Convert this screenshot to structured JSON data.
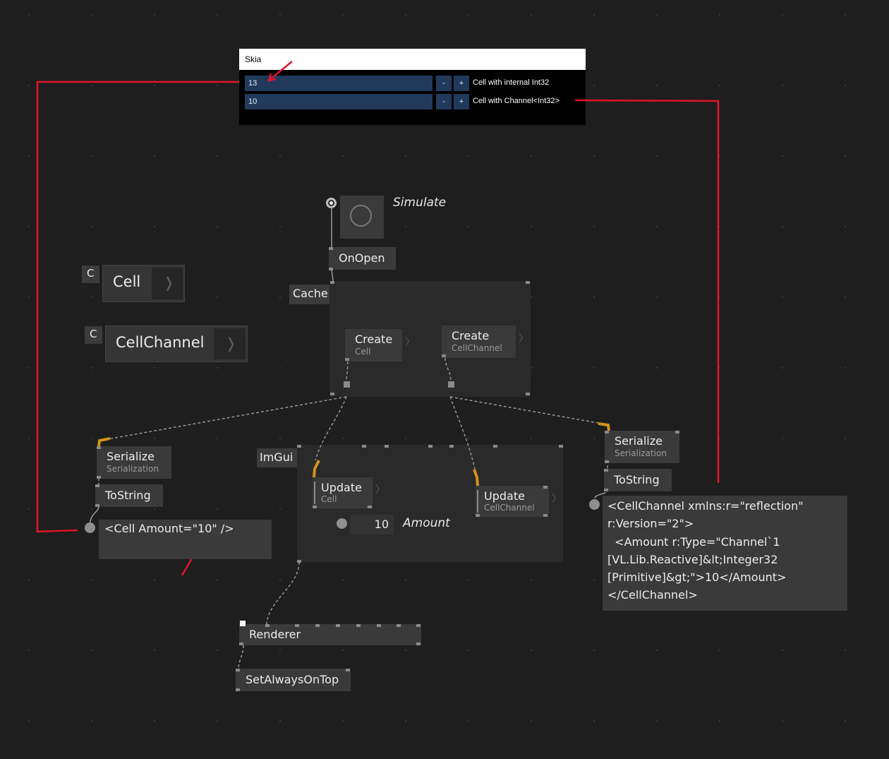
{
  "skia_window": {
    "title": "Skia",
    "rows": [
      {
        "value": "13",
        "minus": "-",
        "plus": "+",
        "label": "Cell with internal Int32"
      },
      {
        "value": "10",
        "minus": "-",
        "plus": "+",
        "label": "Cell with Channel<Int32>"
      }
    ]
  },
  "patch": {
    "simulate_label": "Simulate",
    "on_open": "OnOpen",
    "cache_label": "Cache",
    "class_cell": {
      "badge": "C",
      "name": "Cell",
      "chevron": "❭"
    },
    "class_cellchannel": {
      "badge": "C",
      "name": "CellChannel",
      "chevron": "❭"
    },
    "create_cell": {
      "title": "Create",
      "subtitle": "Cell",
      "chevron": "〉"
    },
    "create_cellchannel": {
      "title": "Create",
      "subtitle": "CellChannel",
      "chevron": "〉"
    },
    "imgui_label": "ImGui",
    "update_cell": {
      "title": "Update",
      "subtitle": "Cell",
      "chevron": "〉"
    },
    "update_cellchannel": {
      "title": "Update",
      "subtitle": "CellChannel",
      "chevron": "〉"
    },
    "amount_value": "10",
    "amount_label": "Amount",
    "serialize_left": {
      "title": "Serialize",
      "subtitle": "Serialization"
    },
    "serialize_right": {
      "title": "Serialize",
      "subtitle": "Serialization"
    },
    "tostring_left": "ToString",
    "tostring_right": "ToString",
    "output_left": "<Cell Amount=\"10\" />",
    "output_right_lines": [
      "<CellChannel xmlns:r=\"reflection\"",
      "r:Version=\"2\">",
      "  <Amount r:Type=\"Channel`1",
      "[VL.Lib.Reactive]&lt;Integer32",
      "[Primitive]&gt;\">10</Amount>",
      "</CellChannel>"
    ],
    "renderer": "Renderer",
    "set_always_on_top": "SetAlwaysOnTop"
  },
  "colors": {
    "background": "#1e1e1e",
    "node": "#3a3a3a",
    "region": "#2a2a2a",
    "skia_field": "#213a5c",
    "annotation_red": "#e0142b",
    "pin_orange": "#d4921c",
    "wire": "#9a9a9a"
  },
  "icons": [
    "toggle-pin-icon",
    "circle-button-icon",
    "chevron-right-icon",
    "red-arrow-icon"
  ]
}
